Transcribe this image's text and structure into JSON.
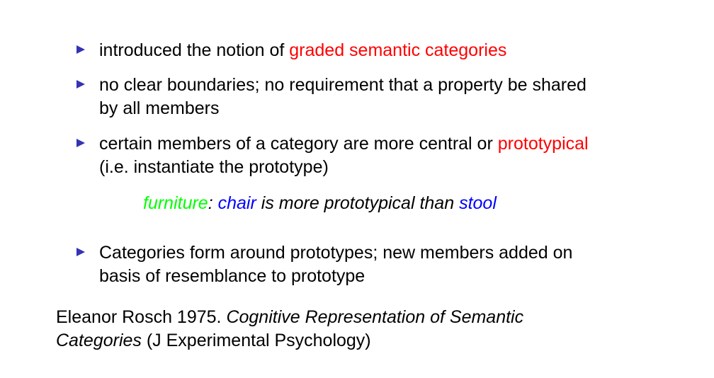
{
  "colors": {
    "bullet_marker": "#3333b3",
    "highlight_red": "#ff0000",
    "highlight_green": "#00ff00",
    "highlight_blue": "#0000ff",
    "text": "#000000"
  },
  "bullets": [
    {
      "icon": "triangle-right-icon",
      "text_before": "introduced the notion of ",
      "highlight": "graded semantic categories"
    },
    {
      "icon": "triangle-right-icon",
      "line1": "no clear boundaries; no requirement that a property be shared",
      "line2": "by all members"
    },
    {
      "icon": "triangle-right-icon",
      "text_before": "certain members of a category are more central or ",
      "highlight": "prototypical",
      "line2": "(i.e. instantiate the prototype)"
    },
    {
      "icon": "triangle-right-icon",
      "line1": "Categories form around prototypes; new members added on",
      "line2": "basis of resemblance to prototype"
    }
  ],
  "example": {
    "category": "furniture",
    "colon": ": ",
    "member1": "chair",
    "middle": " is more prototypical than ",
    "member2": "stool"
  },
  "reference": {
    "author_year": "Eleanor Rosch 1975. ",
    "title_part1": "Cognitive Representation of Semantic",
    "title_part2": "Categories",
    "venue": " (J Experimental Psychology)"
  }
}
